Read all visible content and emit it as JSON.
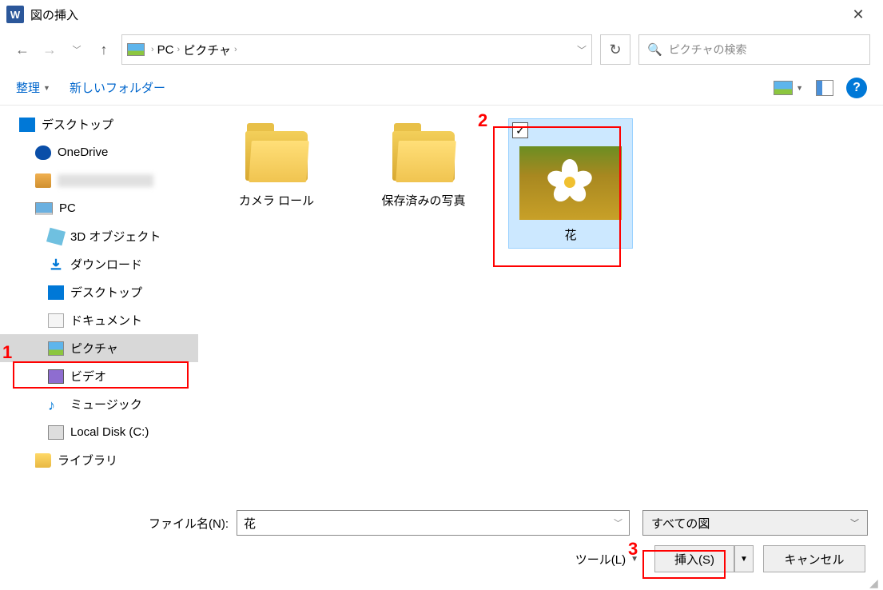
{
  "title": "図の挿入",
  "breadcrumb": {
    "pc": "PC",
    "pictures": "ピクチャ"
  },
  "search_placeholder": "ピクチャの検索",
  "toolbar": {
    "organize": "整理",
    "new_folder": "新しいフォルダー"
  },
  "sidebar": {
    "desktop": "デスクトップ",
    "onedrive": "OneDrive",
    "user": "",
    "pc": "PC",
    "objects3d": "3D オブジェクト",
    "downloads": "ダウンロード",
    "desktop2": "デスクトップ",
    "documents": "ドキュメント",
    "pictures": "ピクチャ",
    "videos": "ビデオ",
    "music": "ミュージック",
    "localdisk": "Local Disk (C:)",
    "library": "ライブラリ"
  },
  "files": {
    "camera_roll": "カメラ ロール",
    "saved_pictures": "保存済みの写真",
    "flower": "花"
  },
  "footer": {
    "filename_label": "ファイル名(N):",
    "filename_value": "花",
    "filter": "すべての図",
    "tools": "ツール(L)",
    "insert": "挿入(S)",
    "cancel": "キャンセル"
  },
  "annotations": {
    "a1": "1",
    "a2": "2",
    "a3": "3"
  }
}
